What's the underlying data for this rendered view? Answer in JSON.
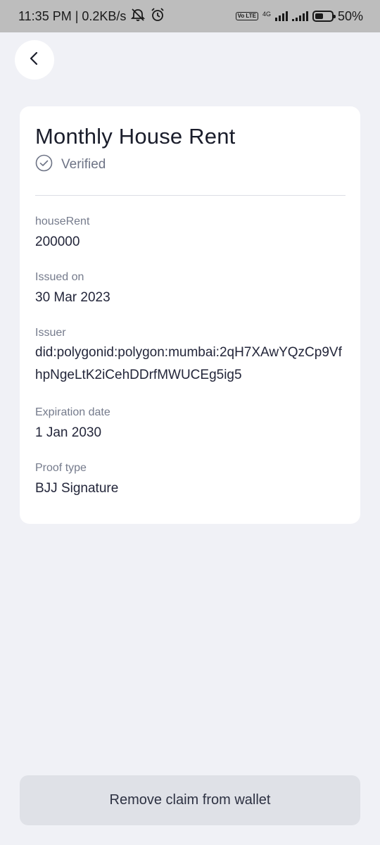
{
  "status_bar": {
    "time_speed": "11:35 PM | 0.2KB/s",
    "volte": "Vo LTE",
    "network": "4G",
    "battery": "50%",
    "battery_level": 0.5
  },
  "credential": {
    "title": "Monthly House Rent",
    "status": "Verified",
    "fields": [
      {
        "label": "houseRent",
        "value": "200000"
      },
      {
        "label": "Issued on",
        "value": "30 Mar 2023"
      },
      {
        "label": "Issuer",
        "value": "did:polygonid:polygon:mumbai:2qH7XAwYQzCp9VfhpNgeLtK2iCehDDrfMWUCEg5ig5"
      },
      {
        "label": "Expiration date",
        "value": "1 Jan 2030"
      },
      {
        "label": "Proof type",
        "value": "BJJ Signature"
      }
    ]
  },
  "actions": {
    "remove_label": "Remove claim from wallet"
  },
  "icons": {
    "back": "chevron-left-icon",
    "verified": "check-circle-icon"
  }
}
